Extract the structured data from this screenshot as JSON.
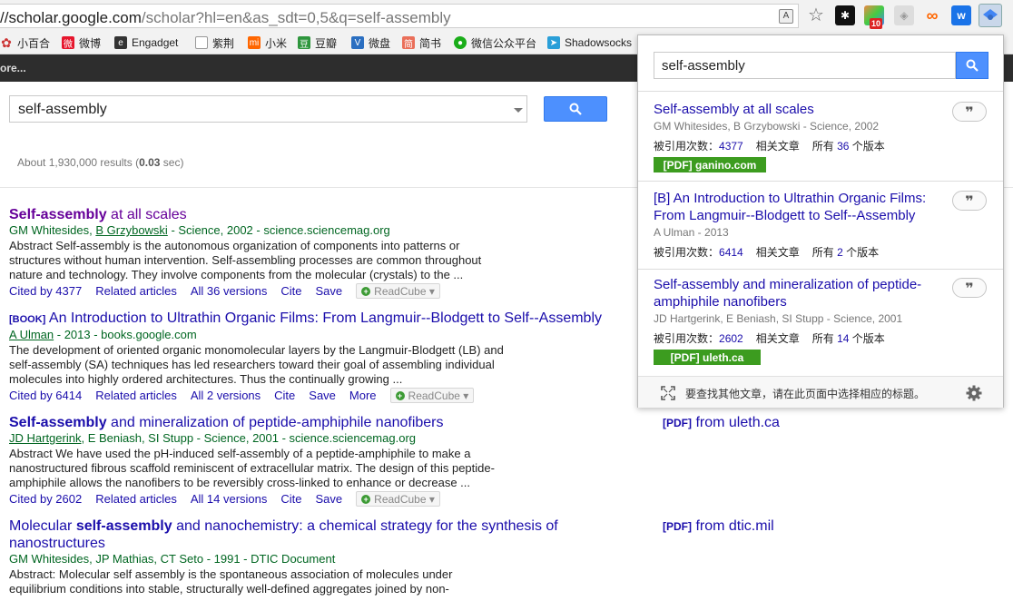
{
  "browser": {
    "url_host": "//scholar.google.com",
    "url_path": "/scholar?hl=en&as_sdt=0,5&q=self-assembly",
    "bookmarks": [
      "小百合",
      "微博",
      "Engadget",
      "紫荆",
      "小米",
      "豆瓣",
      "微盘",
      "简书",
      "微信公众平台",
      "Shadowsocks"
    ],
    "extensions": {
      "badge_count": "10"
    }
  },
  "scholar": {
    "top_bar_text": "ore...",
    "search_value": "self-assembly",
    "results_count_prefix": "About 1,930,000 results (",
    "results_time": "0.03",
    "results_count_suffix": " sec)",
    "results": [
      {
        "tag": "",
        "title_bold": "Self-assembly",
        "title_rest": " at all scales",
        "meta_pre": "GM Whitesides, ",
        "meta_link": "B Grzybowski",
        "meta_post": " - Science, 2002 - science.sciencemag.org",
        "snippet": "Abstract Self-assembly is the autonomous organization of components into patterns or structures without human intervention. Self-assembling processes are common throughout nature and technology. They involve components from the molecular (crystals) to the ...",
        "links": [
          "Cited by 4377",
          "Related articles",
          "All 36 versions",
          "Cite",
          "Save"
        ],
        "readcube": "ReadCube",
        "side": ""
      },
      {
        "tag": "[BOOK]",
        "title_bold": "",
        "title_rest": "An Introduction to Ultrathin Organic Films: From Langmuir--Blodgett to Self--Assembly",
        "meta_pre": "",
        "meta_link": "A Ulman",
        "meta_post": " - 2013 - books.google.com",
        "snippet": "The development of oriented organic monomolecular layers by the Langmuir-Blodgett (LB) and self-assembly (SA) techniques has led researchers toward their goal of assembling individual molecules into highly ordered architectures. Thus the continually growing ...",
        "links": [
          "Cited by 6414",
          "Related articles",
          "All 2 versions",
          "Cite",
          "Save",
          "More"
        ],
        "readcube": "ReadCube",
        "side": ""
      },
      {
        "tag": "",
        "title_bold": "Self-assembly",
        "title_rest": " and mineralization of peptide-amphiphile nanofibers",
        "meta_pre": "",
        "meta_link": "JD Hartgerink",
        "meta_post": ", E Beniash, SI Stupp - Science, 2001 - science.sciencemag.org",
        "snippet": "Abstract We have used the pH-induced self-assembly of a peptide-amphiphile to make a nanostructured fibrous scaffold reminiscent of extracellular matrix. The design of this peptide-amphiphile allows the nanofibers to be reversibly cross-linked to enhance or decrease ...",
        "links": [
          "Cited by 2602",
          "Related articles",
          "All 14 versions",
          "Cite",
          "Save"
        ],
        "readcube": "ReadCube",
        "side_tag": "[PDF]",
        "side": "from uleth.ca"
      },
      {
        "tag": "",
        "title_pre": "Molecular ",
        "title_bold": "self-assembly",
        "title_rest": " and nanochemistry: a chemical strategy for the synthesis of",
        "title_line2": "nanostructures",
        "meta_pre": "",
        "meta_link": "",
        "meta_post": "GM Whitesides, JP Mathias, CT Seto - 1991 - DTIC Document",
        "snippet": "Abstract: Molecular self assembly is the spontaneous association of molecules under equilibrium conditions into stable, structurally well-defined aggregates joined by non-",
        "links": [],
        "readcube": "",
        "side_tag": "[PDF]",
        "side": "from dtic.mil"
      }
    ]
  },
  "popup": {
    "search_value": "self-assembly",
    "items": [
      {
        "title": "Self-assembly at all scales",
        "authors": "GM Whitesides, B Grzybowski - Science, 2002",
        "cited_label": "被引用次数：",
        "cited_num": "4377",
        "related": "相关文章",
        "versions_pre": "所有 ",
        "versions_num": "36",
        "versions_post": " 个版本",
        "pdf": "[PDF] ganino.com",
        "quote": "❞"
      },
      {
        "title": "[B] An Introduction to Ultrathin Organic Films: From Langmuir--Blodgett to Self--Assembly",
        "authors": "A Ulman - 2013",
        "cited_label": "被引用次数：",
        "cited_num": "6414",
        "related": "相关文章",
        "versions_pre": "所有 ",
        "versions_num": "2",
        "versions_post": " 个版本",
        "pdf": "",
        "quote": "❞"
      },
      {
        "title": "Self-assembly and mineralization of peptide-amphiphile nanofibers",
        "authors": "JD Hartgerink, E Beniash, SI Stupp - Science, 2001",
        "cited_label": "被引用次数：",
        "cited_num": "2602",
        "related": "相关文章",
        "versions_pre": "所有 ",
        "versions_num": "14",
        "versions_post": " 个版本",
        "pdf": "[PDF] uleth.ca",
        "quote": "❞"
      }
    ],
    "footer": "要查找其他文章，请在此页面中选择相应的标题。"
  },
  "colors": {
    "link": "#1a0dab",
    "visited": "#660099",
    "meta_green": "#006621",
    "button_blue": "#4d90fe",
    "pdf_green": "#3c9c1f"
  }
}
